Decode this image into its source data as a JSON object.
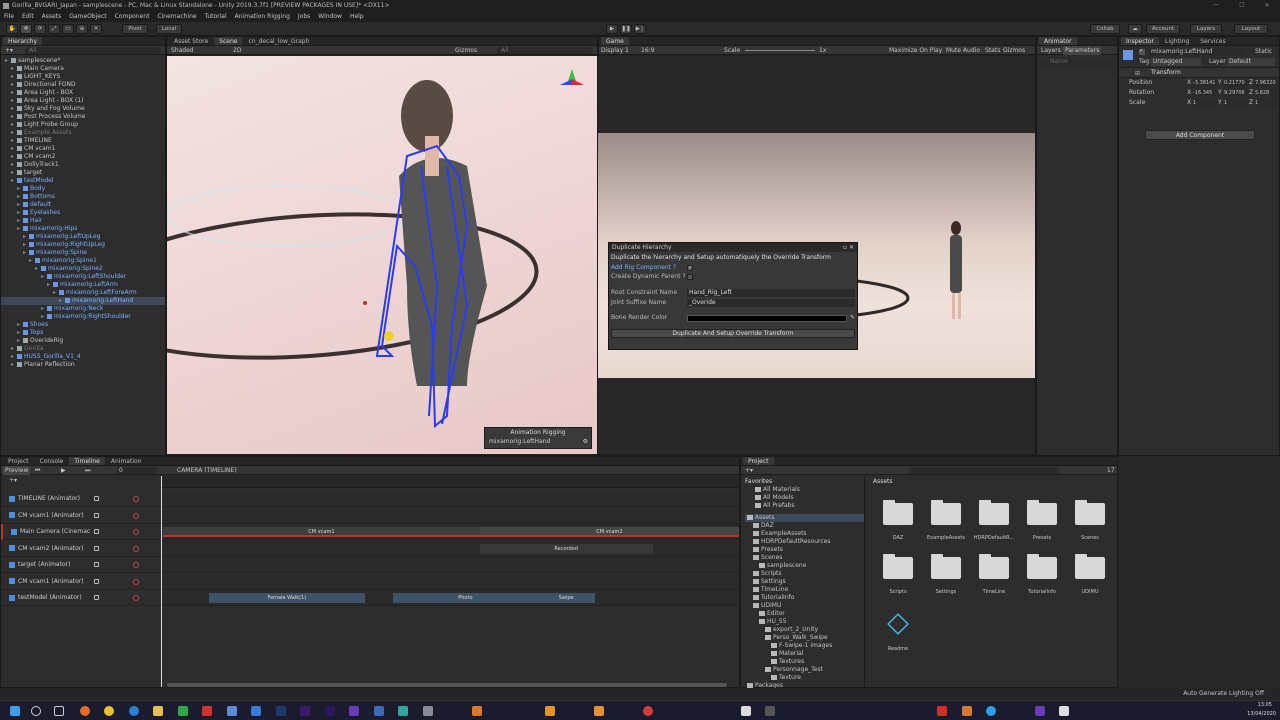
{
  "window": {
    "title": "Gorilla_BVGARI_Japan - samplescene - PC, Mac & Linux Standalone - Unity 2019.3.7f1 [PREVIEW PACKAGES IN USE]* <DX11>"
  },
  "menu": [
    "File",
    "Edit",
    "Assets",
    "GameObject",
    "Component",
    "Cinemachine",
    "Tutorial",
    "Animation Rigging",
    "Jobs",
    "Window",
    "Help"
  ],
  "toolbar": {
    "pivot": "Pivot",
    "local": "Local",
    "collab": "Collab",
    "account": "Account",
    "layers": "Layers",
    "layout": "Layout"
  },
  "hierarchy": {
    "tab": "Hierarchy",
    "search_placeholder": "All",
    "items": [
      {
        "label": "samplescene*",
        "indent": 0,
        "blue": false,
        "sel": false
      },
      {
        "label": "Main Camera",
        "indent": 1
      },
      {
        "label": "LIGHT_KEYS",
        "indent": 1
      },
      {
        "label": "Directional FOND",
        "indent": 1
      },
      {
        "label": "Area Light - BOX",
        "indent": 1
      },
      {
        "label": "Area Light - BOX (1)",
        "indent": 1
      },
      {
        "label": "Sky and Fog Volume",
        "indent": 1
      },
      {
        "label": "Post Process Volume",
        "indent": 1
      },
      {
        "label": "Light Probe Group",
        "indent": 1
      },
      {
        "label": "Example Assets",
        "indent": 1,
        "dim": true
      },
      {
        "label": "TIMELINE",
        "indent": 1
      },
      {
        "label": "CM vcam1",
        "indent": 1
      },
      {
        "label": "CM vcam2",
        "indent": 1
      },
      {
        "label": "DollyTrack1",
        "indent": 1
      },
      {
        "label": "target",
        "indent": 1
      },
      {
        "label": "testModel",
        "indent": 1,
        "blue": true
      },
      {
        "label": "Body",
        "indent": 2,
        "blue": true
      },
      {
        "label": "Bottoms",
        "indent": 2,
        "blue": true
      },
      {
        "label": "default",
        "indent": 2,
        "blue": true
      },
      {
        "label": "Eyelashes",
        "indent": 2,
        "blue": true
      },
      {
        "label": "Hair",
        "indent": 2,
        "blue": true
      },
      {
        "label": "mixamorig:Hips",
        "indent": 2,
        "blue": true
      },
      {
        "label": "mixamorig:LeftUpLeg",
        "indent": 3,
        "blue": true
      },
      {
        "label": "mixamorig:RightUpLeg",
        "indent": 3,
        "blue": true
      },
      {
        "label": "mixamorig:Spine",
        "indent": 3,
        "blue": true
      },
      {
        "label": "mixamorig:Spine1",
        "indent": 4,
        "blue": true
      },
      {
        "label": "mixamorig:Spine2",
        "indent": 5,
        "blue": true
      },
      {
        "label": "mixamorig:LeftShoulder",
        "indent": 6,
        "blue": true
      },
      {
        "label": "mixamorig:LeftArm",
        "indent": 7,
        "blue": true
      },
      {
        "label": "mixamorig:LeftForeArm",
        "indent": 8,
        "blue": true
      },
      {
        "label": "mixamorig:LeftHand",
        "indent": 9,
        "blue": true,
        "sel": true
      },
      {
        "label": "mixamorig:Neck",
        "indent": 6,
        "blue": true
      },
      {
        "label": "mixamorig:RightShoulder",
        "indent": 6,
        "blue": true
      },
      {
        "label": "Shoes",
        "indent": 2,
        "blue": true
      },
      {
        "label": "Tops",
        "indent": 2,
        "blue": true
      },
      {
        "label": "OverideRig",
        "indent": 2
      },
      {
        "label": "Gorilla",
        "indent": 1,
        "dim": true
      },
      {
        "label": "HUSS_Gorilla_V1_4",
        "indent": 1,
        "blue": true
      },
      {
        "label": "Planar Reflection",
        "indent": 1
      }
    ]
  },
  "scene": {
    "tabs": [
      "Asset Store",
      "Scene",
      "cn_decal_low_Graph"
    ],
    "shading": "Shaded",
    "mode": "2D",
    "gizmos": "Gizmos",
    "search": "All",
    "overlay_title": "Animation Rigging",
    "overlay_value": "mixamorig:LeftHand"
  },
  "game": {
    "tab": "Game",
    "display": "Display 1",
    "aspect": "16:9",
    "scale_label": "Scale",
    "scale_value": "1x",
    "opts": [
      "Maximize On Play",
      "Mute Audio",
      "Stats",
      "Gizmos"
    ]
  },
  "dialog": {
    "title": "Duplicate Hierarchy",
    "heading": "Duplicate the hierarchy and Setup automatiquely the Override Transform",
    "add_rig": "Add Rig Component ?",
    "create_parent": "Create Dynamic Parent ?",
    "root_label": "Root Constraint Name",
    "root_value": "Hand_Rig_Left",
    "suffix_label": "Joint Suffixe Name",
    "suffix_value": "_Overide",
    "color_label": "Bone Render Color",
    "button": "Duplicate And Setup Override Transform"
  },
  "animator": {
    "tabs": [
      "Animator"
    ],
    "sub": [
      "Layers",
      "Parameters"
    ],
    "search": "Name"
  },
  "inspector": {
    "tabs": [
      "Inspector",
      "Lighting",
      "Services"
    ],
    "object": "mixamorig:LeftHand",
    "static": "Static",
    "tag_label": "Tag",
    "tag": "Untagged",
    "layer_label": "Layer",
    "layer": "Default",
    "component": "Transform",
    "rows": [
      {
        "label": "Position",
        "x": "-3.38141",
        "y": "0.21770",
        "z": "7.96320"
      },
      {
        "label": "Rotation",
        "x": "-16.345",
        "y": "9.29706",
        "z": "5.828"
      },
      {
        "label": "Scale",
        "x": "1",
        "y": "1",
        "z": "1"
      }
    ],
    "add_component": "Add Component"
  },
  "timeline": {
    "tabs": [
      "Project",
      "Console",
      "Timeline",
      "Animation"
    ],
    "preview": "Preview",
    "frame": "0",
    "asset": "CAMERA (TIMELINE)",
    "tracks": [
      "TIMELINE (Animator)",
      "CM vcam1 (Animator)",
      "Main Camera (Cinemac",
      "CM vcam2 (Animator)",
      "target (Animator)",
      "CM vcam1 (Animator)",
      "testModel (Animator)"
    ],
    "clips": [
      {
        "label": "CM vcam1",
        "track": 2,
        "start": 0.0,
        "end": 0.55
      },
      {
        "label": "CM vcam2",
        "track": 2,
        "start": 0.55,
        "end": 1.0
      },
      {
        "label": "Recorded",
        "track": 3,
        "start": 0.55,
        "end": 0.85
      },
      {
        "label": "Female Walk(1)",
        "track": 6,
        "start": 0.08,
        "end": 0.35
      },
      {
        "label": "Photo",
        "track": 6,
        "start": 0.4,
        "end": 0.65
      },
      {
        "label": "Swipe",
        "track": 6,
        "start": 0.65,
        "end": 0.75
      }
    ]
  },
  "project": {
    "tab": "Project",
    "favorites": "Favorites",
    "fav_items": [
      "All Materials",
      "All Models",
      "All Prefabs"
    ],
    "tree": [
      "Assets",
      "DAZ",
      "ExampleAssets",
      "HDRPDefaultResources",
      "Presets",
      "Scenes",
      "samplescene",
      "Scripts",
      "Settings",
      "TimeLine",
      "TutorialInfo",
      "UDIMU",
      "Editor",
      "HU_55",
      "export_2_Unity",
      "Perso_Walk_Swipe",
      "F-Swipe-1 images",
      "Material",
      "Textures",
      "Personnage_Test",
      "Texture",
      "Packages"
    ],
    "assets_title": "Assets",
    "folders": [
      "DAZ",
      "ExampleAssets",
      "HDRPDefaultR...",
      "Presets",
      "Scenes",
      "Scripts",
      "Settings",
      "TimeLine",
      "TutorialInfo",
      "UDIMU"
    ],
    "readme": "Readme",
    "count": "17"
  },
  "status": {
    "right": "Auto Generate Lighting Off"
  },
  "taskbar": {
    "time": "13:05",
    "date": "13/04/2020"
  }
}
